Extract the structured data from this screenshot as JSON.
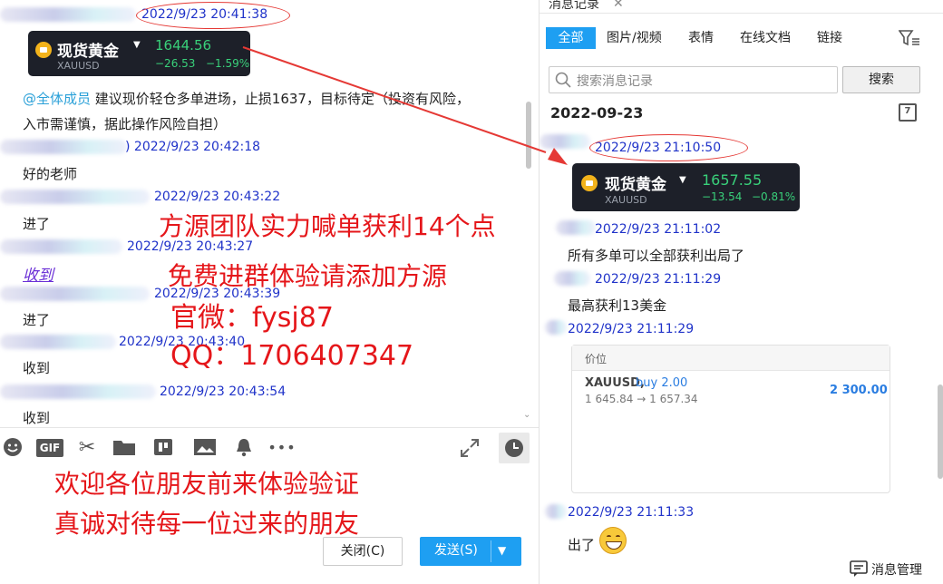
{
  "left": {
    "messages": [
      {
        "ts": "2022/9/23 20:41:38"
      },
      {
        "card": {
          "name": "现货黄金",
          "price": "1644.56",
          "symbol": "XAUUSD",
          "change": "−26.53",
          "pct": "−1.59%"
        }
      },
      {
        "mention": "@全体成员",
        "text1": "建议现价轻仓多单进场，止损1637，目标待定（投资有风险，",
        "text2": "入市需谨慎，据此操作风险自担）"
      },
      {
        "ts": ") 2022/9/23 20:42:18",
        "text": "好的老师"
      },
      {
        "ts": "2022/9/23 20:43:22",
        "text": "进了"
      },
      {
        "ts": "2022/9/23 20:43:27",
        "text": "收到"
      },
      {
        "ts": "2022/9/23 20:43:39",
        "text": "进了"
      },
      {
        "ts": "2022/9/23 20:43:40",
        "text": "收到"
      },
      {
        "ts": "2022/9/23 20:43:54",
        "text": "收到"
      }
    ],
    "toolbar": {
      "gif": "GIF",
      "more": "•••"
    },
    "close_btn": "关闭(C)",
    "send_btn": "发送(S)"
  },
  "annotations": {
    "line1": "方源团队实力喊单获利14个点",
    "line2": "免费进群体验请添加方源",
    "line3": "官微：fysj87",
    "line4": "QQ：1706407347",
    "line5": "欢迎各位朋友前来体验验证",
    "line6": "真诚对待每一位过来的朋友",
    "accent": "#e5161a"
  },
  "right": {
    "panel_tab": "消息记录",
    "tabs": [
      "全部",
      "图片/视频",
      "表情",
      "在线文档",
      "链接"
    ],
    "search_placeholder": "搜索消息记录",
    "search_btn": "搜索",
    "date": "2022-09-23",
    "calendar_day": "7",
    "messages": [
      {
        "ts": "2022/9/23 21:10:50",
        "card": {
          "name": "现货黄金",
          "price": "1657.55",
          "symbol": "XAUUSD",
          "change": "−13.54",
          "pct": "−0.81%"
        }
      },
      {
        "ts": "2022/9/23 21:11:02",
        "text": "所有多单可以全部获利出局了"
      },
      {
        "ts": "2022/9/23 21:11:29",
        "text": "最高获利13美金"
      },
      {
        "ts": "2022/9/23 21:11:29",
        "position": {
          "title": "价位",
          "symbol": "XAUUSD,",
          "side": "buy 2.00",
          "range": "1 645.84 → 1 657.34",
          "profit": "2 300.00"
        }
      },
      {
        "ts": "2022/9/23 21:11:33",
        "text": "出了"
      }
    ],
    "manage": "消息管理"
  }
}
